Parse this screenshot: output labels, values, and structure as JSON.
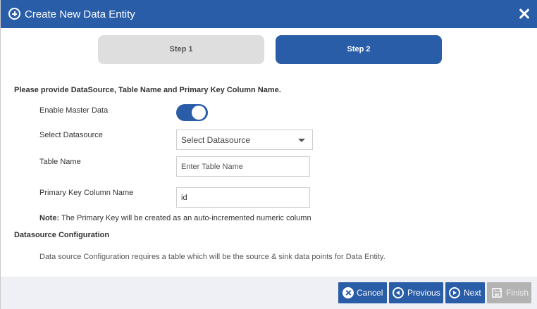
{
  "dialog": {
    "title": "Create New Data Entity",
    "title_icon": "plus-circle-icon",
    "close_icon": "close-icon"
  },
  "steps": [
    {
      "label": "Step 1",
      "active": false
    },
    {
      "label": "Step 2",
      "active": true
    }
  ],
  "form": {
    "lead": "Please provide DataSource, Table Name and Primary Key Column Name.",
    "master_data": {
      "label": "Enable Master Data",
      "enabled": true
    },
    "datasource": {
      "label": "Select Datasource",
      "selected": "Select Datasource"
    },
    "table_name": {
      "label": "Table Name",
      "value": "",
      "placeholder": "Enter Table Name"
    },
    "primary_key": {
      "label": "Primary Key Column Name",
      "value": "id"
    },
    "note_prefix": "Note:",
    "note_text": " The Primary Key will be created as an auto-incremented numeric column"
  },
  "datasource_config": {
    "title": "Datasource Configuration",
    "description": "Data source Configuration requires a table which will be the source & sink data points for Data Entity."
  },
  "footer": {
    "cancel": "Cancel",
    "previous": "Previous",
    "next": "Next",
    "finish": "Finish"
  },
  "colors": {
    "primary": "#2a5da8",
    "inactive_step": "#dedede",
    "disabled_button": "#b3b3b3",
    "footer_bg": "#eef0f5"
  }
}
